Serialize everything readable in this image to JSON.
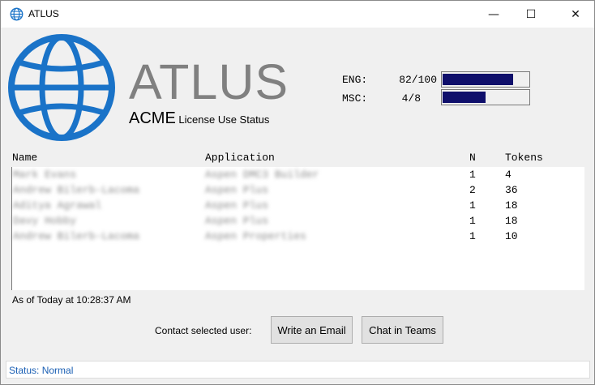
{
  "window": {
    "title": "ATLUS",
    "min_glyph": "—",
    "max_glyph": "☐",
    "close_glyph": "✕"
  },
  "logo": {
    "name": "ATLUS",
    "company": "ACME",
    "tagline": " License Use Status",
    "icon": "globe-icon",
    "color": "#1a73c8"
  },
  "gauges": [
    {
      "label": "ENG:",
      "value": "82/100",
      "fraction": 0.82
    },
    {
      "label": "MSC:",
      "value": "4/8",
      "fraction": 0.5
    }
  ],
  "table": {
    "columns": [
      "Name",
      "Application",
      "N",
      "Tokens"
    ],
    "rows": [
      {
        "name": "Mark Evans",
        "app": "Aspen DMC3 Builder",
        "n": "1",
        "tokens": "4"
      },
      {
        "name": "Andrew Bilerb-Lacoma",
        "app": "Aspen Plus",
        "n": "2",
        "tokens": "36"
      },
      {
        "name": "Aditya Agrawal",
        "app": "Aspen Plus",
        "n": "1",
        "tokens": "18"
      },
      {
        "name": "Davy Hobby",
        "app": "Aspen Plus",
        "n": "1",
        "tokens": "18"
      },
      {
        "name": "Andrew Bilerb-Lacoma",
        "app": "Aspen Properties",
        "n": "1",
        "tokens": "10"
      }
    ]
  },
  "as_of": "As of Today at 10:28:37 AM",
  "contact": {
    "label": "Contact selected user:",
    "email_button": "Write an Email",
    "teams_button": "Chat in Teams"
  },
  "status": "Status: Normal"
}
